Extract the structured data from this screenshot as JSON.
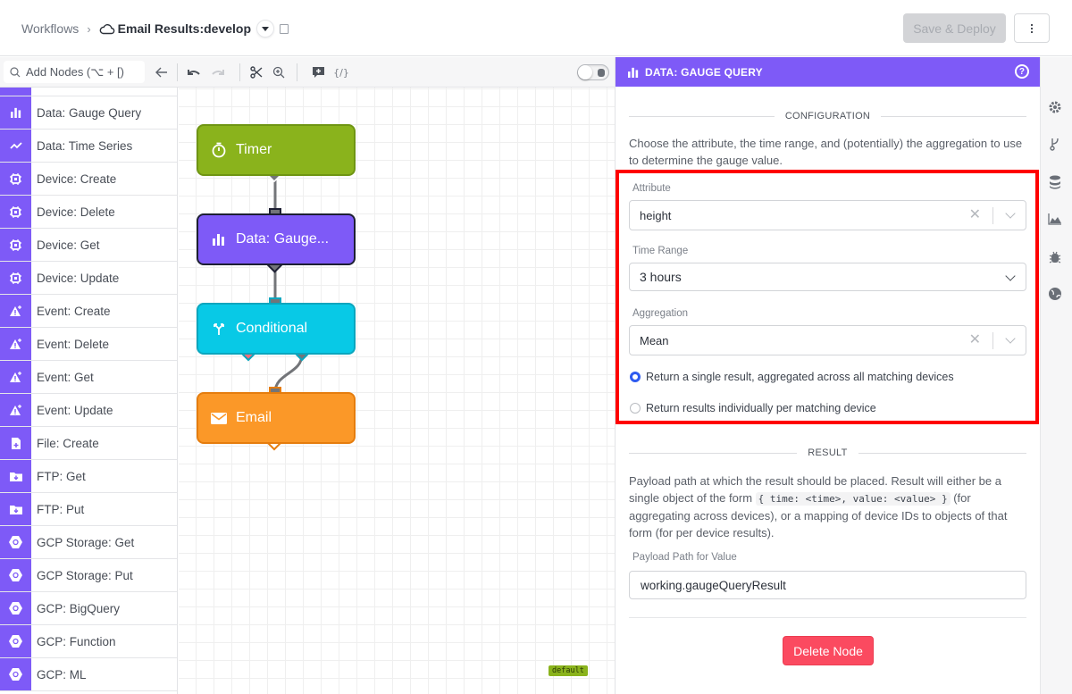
{
  "header": {
    "breadcrumb_root": "Workflows",
    "breadcrumb_sep": "›",
    "workflow_title": "Email Results:develop",
    "save_button": "Save & Deploy",
    "more_icon": "kebab-icon"
  },
  "toolbar": {
    "search_placeholder": "Add Nodes (⌥ + [)",
    "icons": [
      "search-icon",
      "back-arrow-icon",
      "undo-icon",
      "redo-icon",
      "cut-icon",
      "zoom-icon",
      "add-comment-icon",
      "expression-icon",
      "debug-toggle"
    ]
  },
  "node_list": {
    "items": [
      {
        "label": "Data: Gauge Query",
        "icon": "bar-chart-icon"
      },
      {
        "label": "Data: Time Series",
        "icon": "line-chart-icon"
      },
      {
        "label": "Device: Create",
        "icon": "device-create-icon"
      },
      {
        "label": "Device: Delete",
        "icon": "device-delete-icon"
      },
      {
        "label": "Device: Get",
        "icon": "device-get-icon"
      },
      {
        "label": "Device: Update",
        "icon": "device-update-icon"
      },
      {
        "label": "Event: Create",
        "icon": "event-create-icon"
      },
      {
        "label": "Event: Delete",
        "icon": "event-delete-icon"
      },
      {
        "label": "Event: Get",
        "icon": "event-get-icon"
      },
      {
        "label": "Event: Update",
        "icon": "event-update-icon"
      },
      {
        "label": "File: Create",
        "icon": "file-create-icon"
      },
      {
        "label": "FTP: Get",
        "icon": "folder-download-icon"
      },
      {
        "label": "FTP: Put",
        "icon": "folder-upload-icon"
      },
      {
        "label": "GCP Storage: Get",
        "icon": "gcp-download-icon"
      },
      {
        "label": "GCP Storage: Put",
        "icon": "gcp-upload-icon"
      },
      {
        "label": "GCP: BigQuery",
        "icon": "gcp-bigquery-icon"
      },
      {
        "label": "GCP: Function",
        "icon": "gcp-function-icon"
      },
      {
        "label": "GCP: ML",
        "icon": "gcp-ml-icon"
      }
    ]
  },
  "canvas": {
    "nodes": [
      {
        "label": "Timer",
        "icon": "stopwatch-icon",
        "color": "#8ab31c"
      },
      {
        "label": "Data: Gauge...",
        "icon": "bar-chart-icon",
        "color": "#7e5af7"
      },
      {
        "label": "Conditional",
        "icon": "fork-icon",
        "color": "#08c9e6"
      },
      {
        "label": "Email",
        "icon": "envelope-icon",
        "color": "#fb9828"
      }
    ],
    "default_tag": "default"
  },
  "panel": {
    "title": "DATA: GAUGE QUERY",
    "config_section": "CONFIGURATION",
    "config_desc": "Choose the attribute, the time range, and (potentially) the aggregation to use to determine the gauge value.",
    "attribute_label": "Attribute",
    "attribute_value": "height",
    "time_range_label": "Time Range",
    "time_range_value": "3 hours",
    "aggregation_label": "Aggregation",
    "aggregation_value": "Mean",
    "radio_options": [
      {
        "label": "Return a single result, aggregated across all matching devices",
        "selected": true
      },
      {
        "label": "Return results individually per matching device",
        "selected": false
      }
    ],
    "result_section": "RESULT",
    "result_desc_1": "Payload path at which the result should be placed. Result will either be a single object of the form",
    "result_code": "{ time: <time>, value: <value> }",
    "result_desc_2": "(for aggregating across devices), or a mapping of device IDs to objects of that form (for per device results).",
    "payload_label": "Payload Path for Value",
    "payload_value": "working.gaugeQueryResult",
    "delete_button": "Delete Node"
  },
  "rail": {
    "icons": [
      "gear-icon",
      "branch-icon",
      "database-icon",
      "area-chart-icon",
      "bug-icon",
      "globe-icon"
    ]
  },
  "colors": {
    "accent": "#7e5af7",
    "highlight": "#ff0000",
    "delete": "#fb4a60",
    "radio_selected": "#2e5bf0"
  }
}
